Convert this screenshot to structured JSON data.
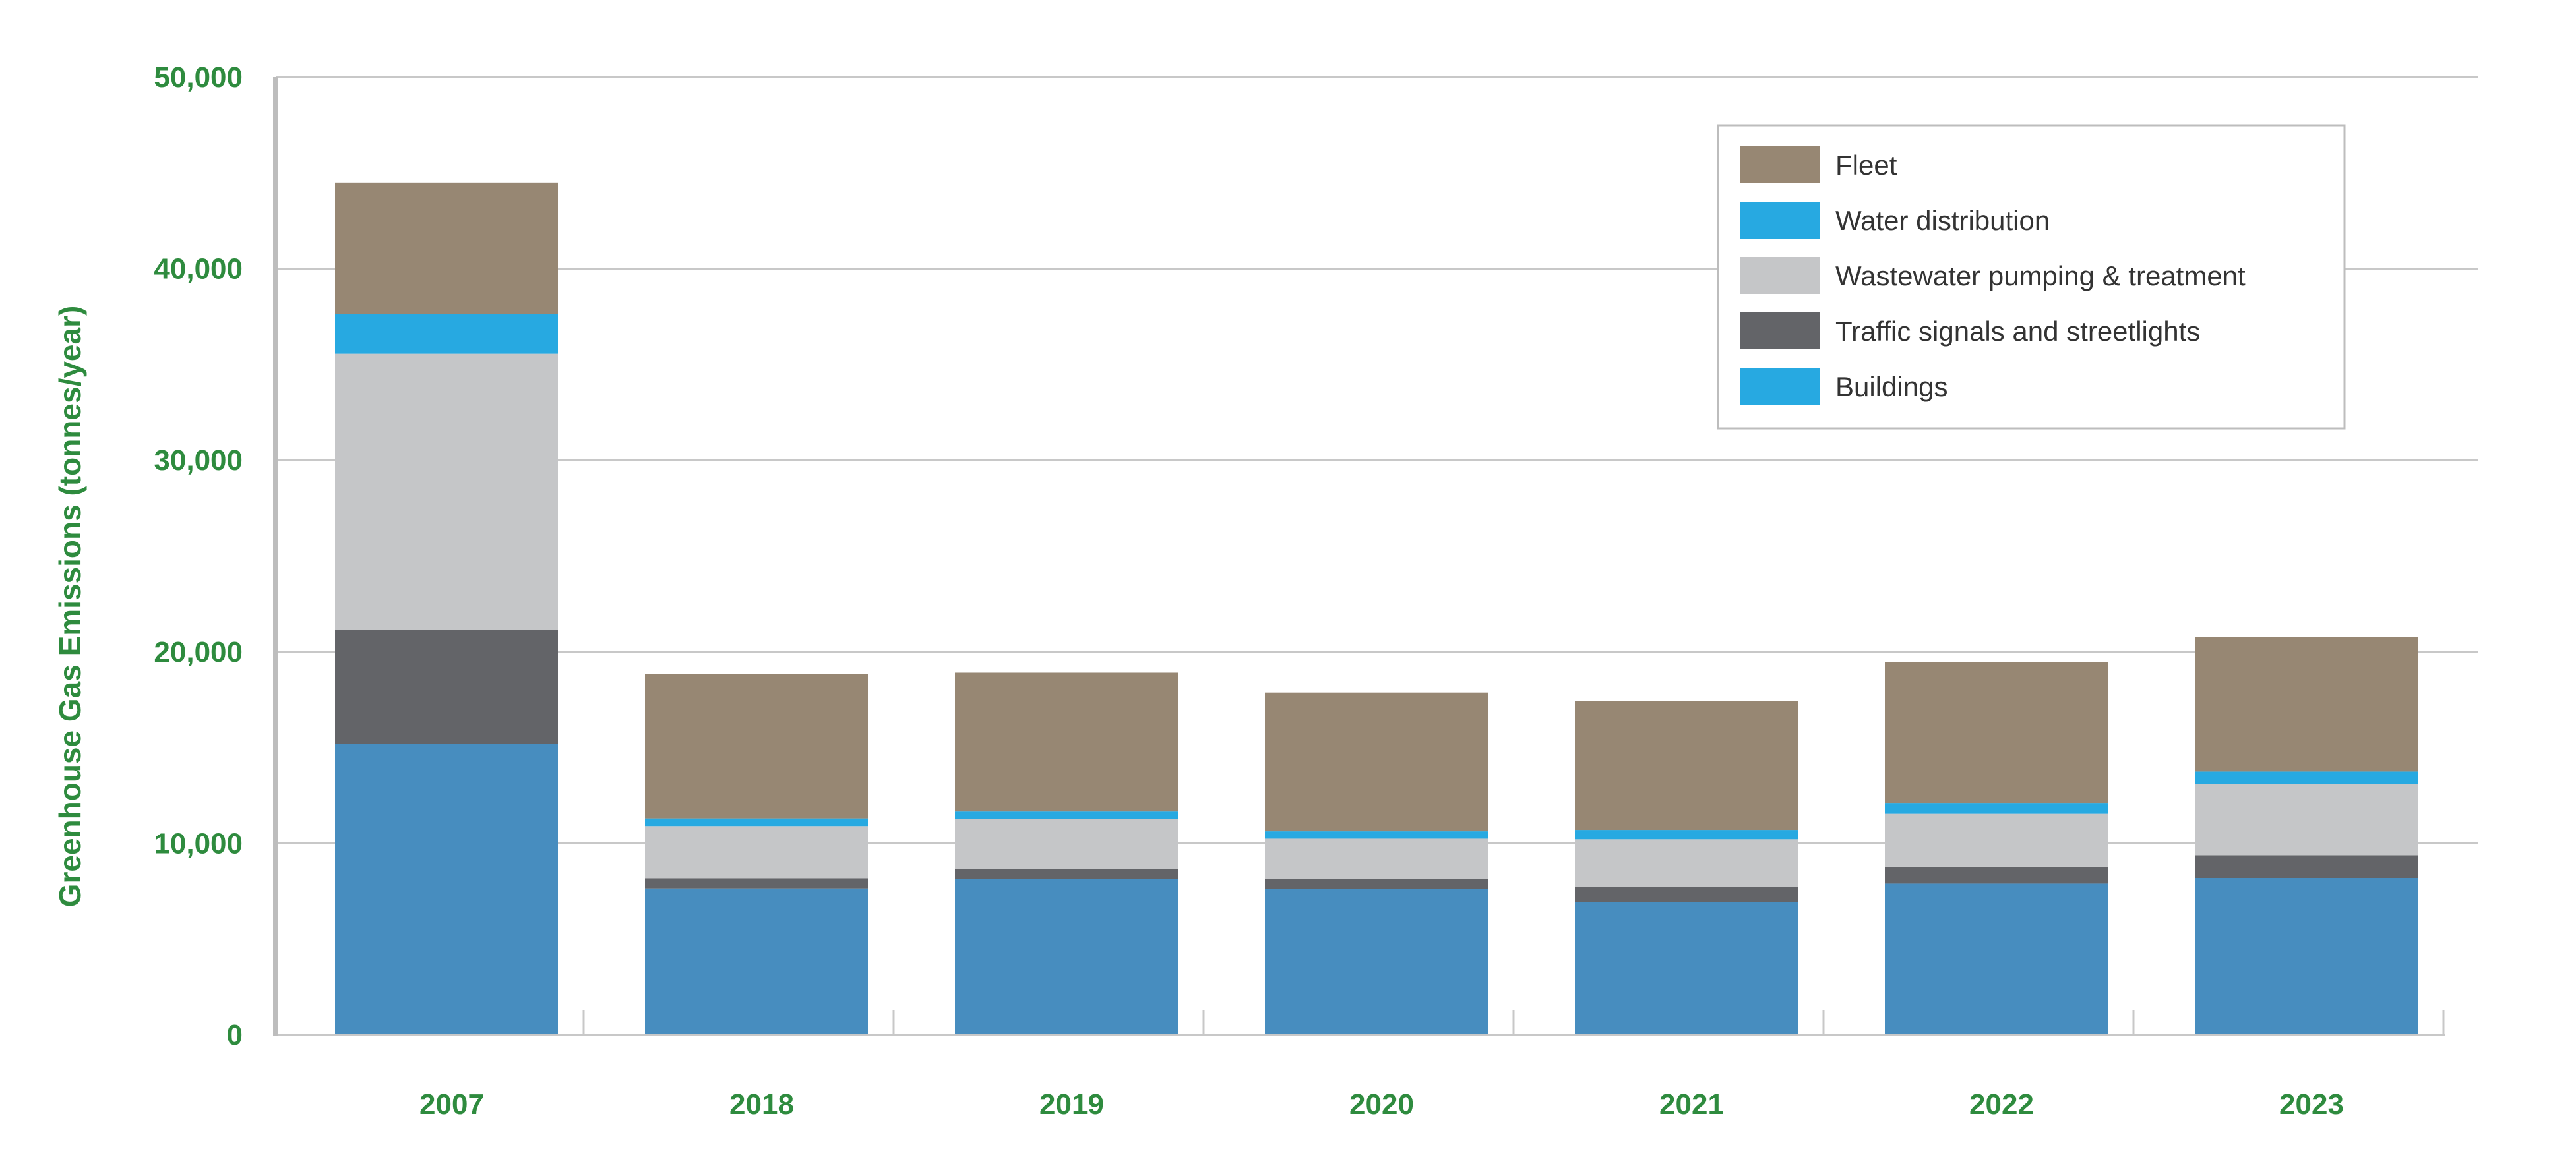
{
  "chart_data": {
    "type": "bar",
    "stacked": true,
    "title": "",
    "xlabel": "",
    "ylabel": "Greenhouse Gas Emissions (tonnes/year)",
    "ylim": [
      0,
      50000
    ],
    "yticks": [
      "0",
      "10,000",
      "20,000",
      "30,000",
      "40,000",
      "50,000"
    ],
    "ytick_values": [
      0,
      10000,
      20000,
      30000,
      40000,
      50000
    ],
    "grid": true,
    "legend_position": "top-right",
    "categories": [
      "2007",
      "2018",
      "2019",
      "2020",
      "2021",
      "2022",
      "2023"
    ],
    "series": [
      {
        "name": "Buildings",
        "color": "#478dbf",
        "legend_color": "#27a9e1",
        "values": [
          15190,
          7650,
          8140,
          7620,
          6930,
          7900,
          8190
        ]
      },
      {
        "name": "Traffic signals and streetlights",
        "color": "#636468",
        "legend_color": "#636468",
        "values": [
          5950,
          530,
          500,
          520,
          790,
          880,
          1190
        ]
      },
      {
        "name": "Wastewater pumping & treatment",
        "color": "#c5c6c8",
        "legend_color": "#c5c6c8",
        "values": [
          14420,
          2720,
          2620,
          2100,
          2490,
          2760,
          3710
        ]
      },
      {
        "name": "Water distribution",
        "color": "#27a9e1",
        "legend_color": "#27a9e1",
        "values": [
          2060,
          400,
          400,
          390,
          490,
          570,
          660
        ]
      },
      {
        "name": "Fleet",
        "color": "#978773",
        "legend_color": "#978773",
        "values": [
          6880,
          7530,
          7250,
          7240,
          6740,
          7350,
          7010
        ]
      }
    ],
    "legend_order": [
      "Fleet",
      "Water distribution",
      "Wastewater pumping & treatment",
      "Traffic signals and streetlights",
      "Buildings"
    ],
    "text_color": "#2e8b3e"
  }
}
